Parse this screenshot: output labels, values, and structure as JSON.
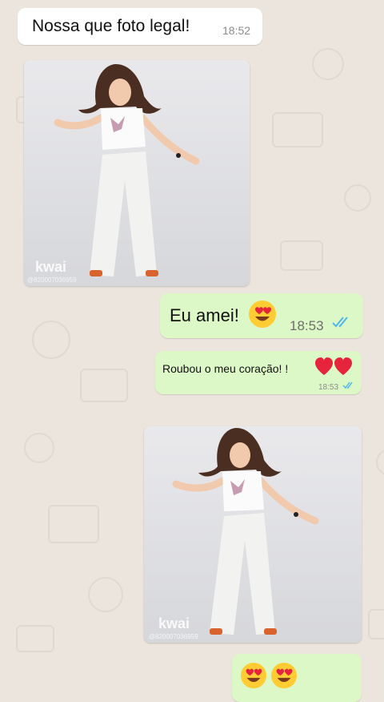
{
  "messages": [
    {
      "type": "text",
      "direction": "incoming",
      "text": "Nossa que foto legal!",
      "time": "18:52"
    },
    {
      "type": "image",
      "direction": "incoming",
      "watermark": "kwai",
      "watermark_id": "@820007036959"
    },
    {
      "type": "text",
      "direction": "outgoing",
      "text": "Eu amei!",
      "emoji": "heart-eyes-emoji",
      "time": "18:53",
      "status": "read"
    },
    {
      "type": "text",
      "direction": "outgoing",
      "text": "Roubou o meu coração!  !",
      "emoji": "red-heart-emoji x2",
      "time": "18:53",
      "status": "read"
    },
    {
      "type": "image",
      "direction": "outgoing",
      "watermark": "kwai",
      "watermark_id": "@820007036959"
    },
    {
      "type": "emoji",
      "direction": "outgoing",
      "emoji": "heart-eyes-emoji x2"
    }
  ],
  "colors": {
    "background": "#ece5dd",
    "incoming": "#ffffff",
    "outgoing": "#dcf8c6",
    "read_ticks": "#4fb6ec"
  }
}
